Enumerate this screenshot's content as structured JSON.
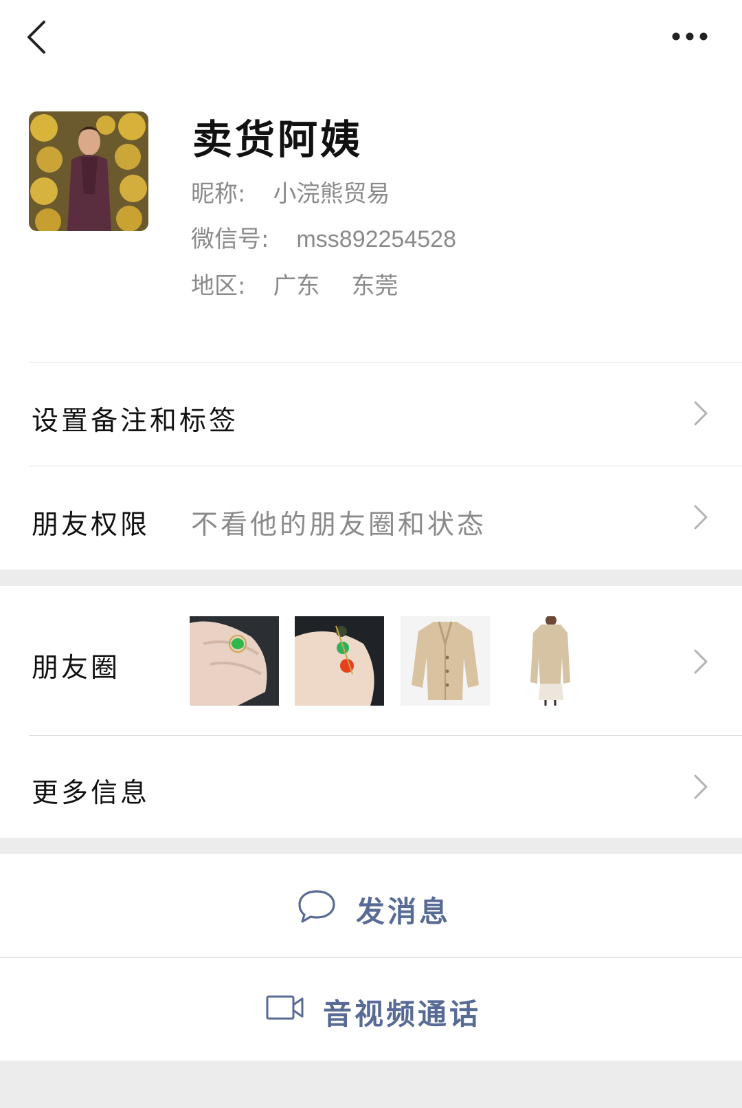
{
  "profile": {
    "display_name": "卖货阿姨",
    "nickname_label": "昵称:",
    "nickname": "小浣熊贸易",
    "wechat_id_label": "微信号:",
    "wechat_id": "mss892254528",
    "region_label": "地区:",
    "region_province": "广东",
    "region_city": "东莞"
  },
  "rows": {
    "remark_tags": "设置备注和标签",
    "friend_permissions_label": "朋友权限",
    "friend_permissions_value": "不看他的朋友圈和状态",
    "moments_label": "朋友圈",
    "more_info": "更多信息"
  },
  "actions": {
    "send_message": "发消息",
    "video_call": "音视频通话"
  },
  "icons": {
    "back": "chevron-left-icon",
    "more": "more-dots-icon",
    "chat": "chat-bubble-icon",
    "video": "video-camera-icon",
    "row_chevron": "chevron-right-icon"
  },
  "colors": {
    "link_blue": "#576b95",
    "secondary_text": "#8a8a8a",
    "background_gray": "#ececec"
  }
}
